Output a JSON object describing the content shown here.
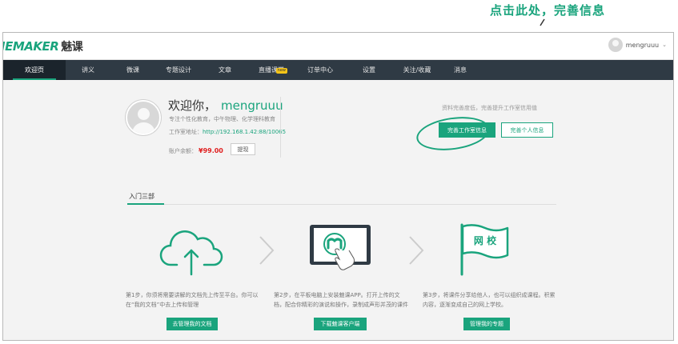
{
  "annotation": {
    "text": "点击此处，完善信息"
  },
  "header": {
    "logo_main": "IEMAKER",
    "logo_cn": "魅课",
    "username": "mengruuu"
  },
  "nav": {
    "items": [
      {
        "label": "欢迎页",
        "active": true
      },
      {
        "label": "讲义"
      },
      {
        "label": "微课"
      },
      {
        "label": "专题设计"
      },
      {
        "label": "文章"
      },
      {
        "label": "直播课堂",
        "badge": "new"
      },
      {
        "label": "订单中心"
      },
      {
        "label": "设置"
      },
      {
        "label": "关注/收藏"
      },
      {
        "label": "消息"
      }
    ]
  },
  "profile": {
    "greeting": "欢迎你，",
    "username": "mengruuu",
    "intro": "专注个性化教育，中午物理、化学理科教育",
    "studio_label": "工作室地址：",
    "studio_url": "http://192.168.1.42:88/10065",
    "balance_label": "账户余额：",
    "balance_amount": "¥99.00",
    "withdraw_label": "提现"
  },
  "completion": {
    "hint": "资料完善度低，完善提升工作室信用值",
    "studio_button": "完善工作室信息",
    "personal_button": "完善个人信息"
  },
  "intro_section": {
    "title": "入门三部",
    "steps": [
      {
        "icon": "cloud-upload-icon",
        "desc_line1": "第1步，你须将需要讲解的文档先上传至平台。你可以",
        "desc_line2": "在“我的文档”中去上传和管理",
        "button": "去管理我的文档"
      },
      {
        "icon": "tablet-app-icon",
        "desc_line1": "第2步，在平板电脑上安装魅课APP。打开上传的文",
        "desc_line2": "档，配合你精彩的演说和操作，录制成声形并茂的课件",
        "button": "下载魅课客户端"
      },
      {
        "icon": "school-flag-icon",
        "flag_text": "网 校",
        "desc_line1": "第3步，将课件分享给他人，也可以组织成课程。积累",
        "desc_line2": "内容，逐渐变成自己的网上学校。",
        "button": "管理我的专题"
      }
    ]
  },
  "colors": {
    "accent": "#1aa47d",
    "nav_bg": "#2f3a44",
    "nav_active": "#1b242c",
    "price": "#e02020"
  }
}
